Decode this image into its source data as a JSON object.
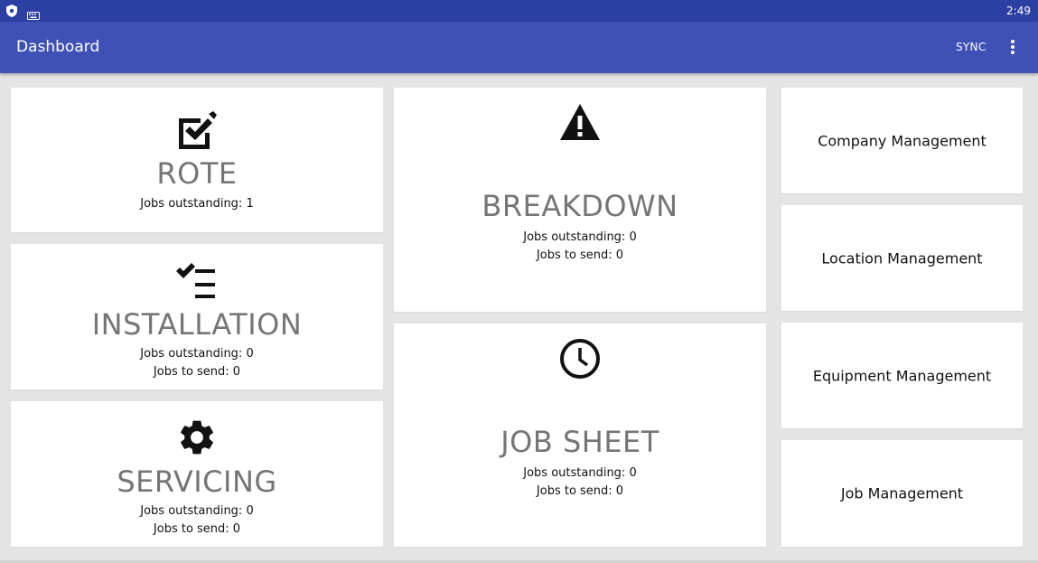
{
  "status_bar": {
    "time": "2:49",
    "icons": [
      "shield-icon",
      "keyboard-icon"
    ]
  },
  "app_bar": {
    "title": "Dashboard",
    "sync_label": "SYNC",
    "menu_icon": "more-vert-icon"
  },
  "tiles": {
    "rote": {
      "title": "ROTE",
      "outstanding": "Jobs outstanding: 1",
      "icon": "checkbox-edit-icon"
    },
    "installation": {
      "title": "INSTALLATION",
      "outstanding": "Jobs outstanding: 0",
      "to_send": "Jobs to send: 0",
      "icon": "checklist-icon"
    },
    "servicing": {
      "title": "SERVICING",
      "outstanding": "Jobs outstanding: 0",
      "to_send": "Jobs to send: 0",
      "icon": "gear-icon"
    },
    "breakdown": {
      "title": "BREAKDOWN",
      "outstanding": "Jobs outstanding: 0",
      "to_send": "Jobs to send: 0",
      "icon": "warning-icon"
    },
    "job_sheet": {
      "title": "JOB SHEET",
      "outstanding": "Jobs outstanding: 0",
      "to_send": "Jobs to send: 0",
      "icon": "clock-icon"
    }
  },
  "management": [
    {
      "label": "Company Management"
    },
    {
      "label": "Location Management"
    },
    {
      "label": "Equipment Management"
    },
    {
      "label": "Job Management"
    }
  ]
}
